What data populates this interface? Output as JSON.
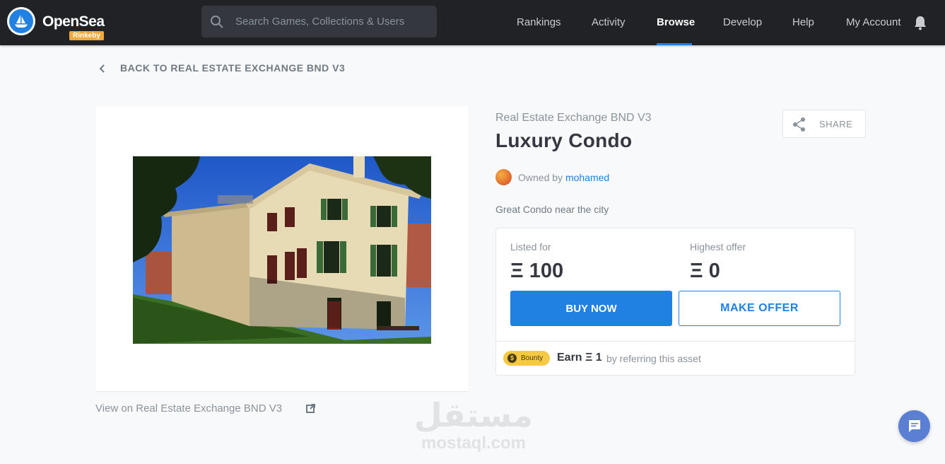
{
  "header": {
    "brand": "OpenSea",
    "network_badge": "Rinkeby",
    "search_placeholder": "Search Games, Collections & Users",
    "nav": [
      "Rankings",
      "Activity",
      "Browse",
      "Develop",
      "Help",
      "My Account"
    ],
    "active_nav": "Browse"
  },
  "back_link": "BACK TO REAL ESTATE EXCHANGE BND V3",
  "asset": {
    "collection": "Real Estate Exchange BND V3",
    "name": "Luxury Condo",
    "owned_by_label": "Owned by",
    "owner": "mohamed",
    "description": "Great Condo near the city",
    "view_on": "View on Real Estate Exchange BND V3"
  },
  "share_label": "SHARE",
  "pricing": {
    "listed_label": "Listed for",
    "listed_value": "Ξ 100",
    "offer_label": "Highest offer",
    "offer_value": "Ξ 0",
    "buy_label": "BUY NOW",
    "offer_button_label": "MAKE OFFER"
  },
  "bounty": {
    "badge": "Bounty",
    "coin_glyph": "$",
    "earn": "Earn Ξ 1",
    "sub": "by referring this asset"
  },
  "watermark": {
    "arabic": "مستقل",
    "latin": "mostaql.com"
  },
  "colors": {
    "accent": "#2081e2",
    "header_bg": "#202225",
    "badge": "#f2a93b",
    "bounty": "#f6c945"
  },
  "icons": [
    "opensea-logo-icon",
    "search-icon",
    "bell-icon",
    "chevron-left-icon",
    "share-icon",
    "external-link-icon",
    "coin-icon",
    "chat-icon"
  ]
}
